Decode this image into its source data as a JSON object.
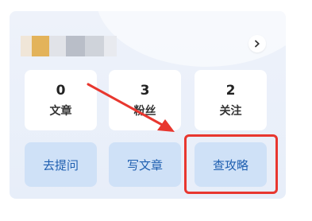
{
  "profile": {
    "avatar_pixels": [
      "#f0e6d8",
      "#e3b35a",
      "#e1e3e8",
      "#b9bec8",
      "#cfd3da",
      "#e8eaef"
    ],
    "more_icon": "chevron-right-icon"
  },
  "stats": [
    {
      "value": "0",
      "label": "文章"
    },
    {
      "value": "3",
      "label": "粉丝"
    },
    {
      "value": "2",
      "label": "关注"
    }
  ],
  "actions": [
    {
      "label": "去提问"
    },
    {
      "label": "写文章"
    },
    {
      "label": "查攻略"
    }
  ],
  "annotation": {
    "color": "#e8372f",
    "highlight_target": "查攻略"
  }
}
